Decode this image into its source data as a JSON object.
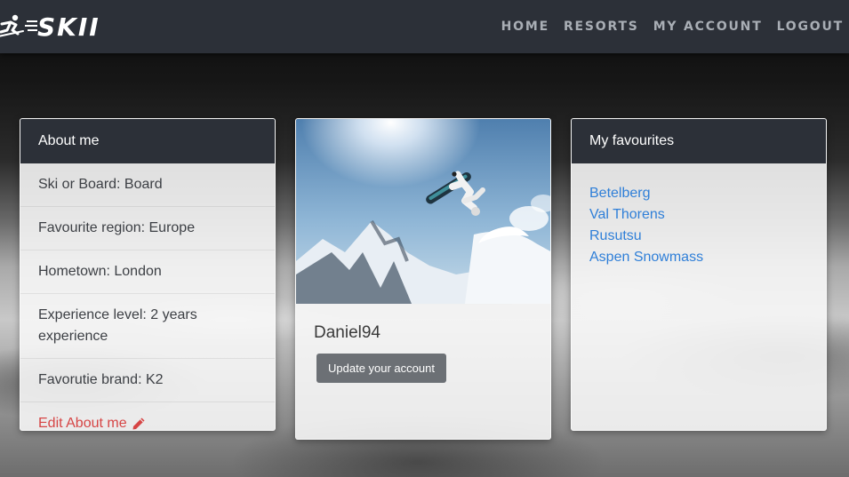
{
  "brand": {
    "name": "SKII"
  },
  "nav": {
    "items": [
      "HOME",
      "RESORTS",
      "MY ACCOUNT",
      "LOGOUT"
    ]
  },
  "about": {
    "title": "About me",
    "items": [
      "Ski or Board: Board",
      "Favourite region: Europe",
      "Hometown: London",
      "Experience level: 2 years experience",
      "Favorutie brand: K2"
    ],
    "edit_label": "Edit About me"
  },
  "profile": {
    "username": "Daniel94",
    "update_button": "Update your account"
  },
  "favourites": {
    "title": "My favourites",
    "items": [
      "Betelberg",
      "Val Thorens",
      "Rusutsu",
      "Aspen Snowmass"
    ]
  },
  "colors": {
    "navbar": "#2c3038",
    "link": "#2f7fd8",
    "edit": "#d64545",
    "button": "#6c7075"
  }
}
